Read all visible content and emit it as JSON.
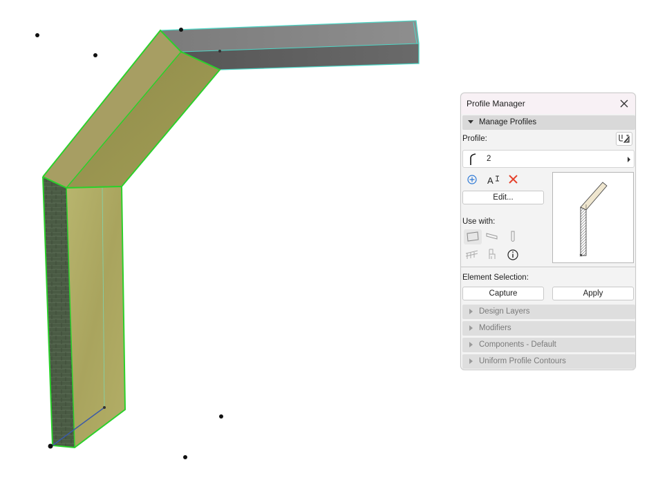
{
  "palette": {
    "title": "Profile Manager",
    "manage_profiles": "Manage Profiles",
    "profile_label": "Profile:",
    "profile_value": "2",
    "edit_label": "Edit...",
    "use_with_label": "Use with:",
    "element_selection_label": "Element Selection:",
    "capture_label": "Capture",
    "apply_label": "Apply",
    "sections": [
      "Design Layers",
      "Modifiers",
      "Components - Default",
      "Uniform Profile Contours"
    ]
  },
  "icons": {
    "close": "close-icon",
    "profile_settings": "profile-settings-icon",
    "add": "add-profile-icon",
    "rename": "rename-text-icon",
    "delete": "delete-icon",
    "wall": "wall-tool-icon",
    "beam": "beam-tool-icon",
    "column": "column-tool-icon",
    "railing": "railing-tool-icon",
    "object": "object-tool-icon",
    "info": "info-icon"
  },
  "colors": {
    "selection_green": "#2bd12b",
    "delete_red": "#e5412b",
    "add_blue": "#2b78d6"
  }
}
